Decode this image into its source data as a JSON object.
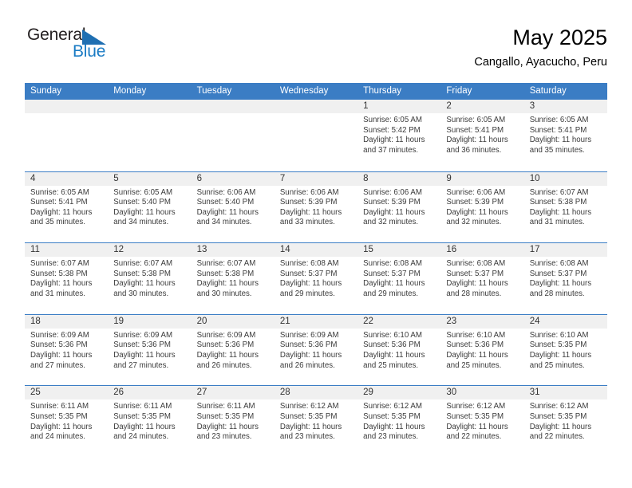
{
  "brand": {
    "name_part1": "General",
    "name_part2": "Blue",
    "flag_icon": "triangle-flag-icon"
  },
  "header": {
    "month_title": "May 2025",
    "location": "Cangallo, Ayacucho, Peru"
  },
  "calendar": {
    "accent_color": "#3b7dc4",
    "daynum_band_color": "#f0f0f0",
    "weekday_headers": [
      "Sunday",
      "Monday",
      "Tuesday",
      "Wednesday",
      "Thursday",
      "Friday",
      "Saturday"
    ],
    "weeks": [
      [
        {
          "day": "",
          "empty": true
        },
        {
          "day": "",
          "empty": true
        },
        {
          "day": "",
          "empty": true
        },
        {
          "day": "",
          "empty": true
        },
        {
          "day": "1",
          "sunrise": "Sunrise: 6:05 AM",
          "sunset": "Sunset: 5:42 PM",
          "daylight": "Daylight: 11 hours and 37 minutes."
        },
        {
          "day": "2",
          "sunrise": "Sunrise: 6:05 AM",
          "sunset": "Sunset: 5:41 PM",
          "daylight": "Daylight: 11 hours and 36 minutes."
        },
        {
          "day": "3",
          "sunrise": "Sunrise: 6:05 AM",
          "sunset": "Sunset: 5:41 PM",
          "daylight": "Daylight: 11 hours and 35 minutes."
        }
      ],
      [
        {
          "day": "4",
          "sunrise": "Sunrise: 6:05 AM",
          "sunset": "Sunset: 5:41 PM",
          "daylight": "Daylight: 11 hours and 35 minutes."
        },
        {
          "day": "5",
          "sunrise": "Sunrise: 6:05 AM",
          "sunset": "Sunset: 5:40 PM",
          "daylight": "Daylight: 11 hours and 34 minutes."
        },
        {
          "day": "6",
          "sunrise": "Sunrise: 6:06 AM",
          "sunset": "Sunset: 5:40 PM",
          "daylight": "Daylight: 11 hours and 34 minutes."
        },
        {
          "day": "7",
          "sunrise": "Sunrise: 6:06 AM",
          "sunset": "Sunset: 5:39 PM",
          "daylight": "Daylight: 11 hours and 33 minutes."
        },
        {
          "day": "8",
          "sunrise": "Sunrise: 6:06 AM",
          "sunset": "Sunset: 5:39 PM",
          "daylight": "Daylight: 11 hours and 32 minutes."
        },
        {
          "day": "9",
          "sunrise": "Sunrise: 6:06 AM",
          "sunset": "Sunset: 5:39 PM",
          "daylight": "Daylight: 11 hours and 32 minutes."
        },
        {
          "day": "10",
          "sunrise": "Sunrise: 6:07 AM",
          "sunset": "Sunset: 5:38 PM",
          "daylight": "Daylight: 11 hours and 31 minutes."
        }
      ],
      [
        {
          "day": "11",
          "sunrise": "Sunrise: 6:07 AM",
          "sunset": "Sunset: 5:38 PM",
          "daylight": "Daylight: 11 hours and 31 minutes."
        },
        {
          "day": "12",
          "sunrise": "Sunrise: 6:07 AM",
          "sunset": "Sunset: 5:38 PM",
          "daylight": "Daylight: 11 hours and 30 minutes."
        },
        {
          "day": "13",
          "sunrise": "Sunrise: 6:07 AM",
          "sunset": "Sunset: 5:38 PM",
          "daylight": "Daylight: 11 hours and 30 minutes."
        },
        {
          "day": "14",
          "sunrise": "Sunrise: 6:08 AM",
          "sunset": "Sunset: 5:37 PM",
          "daylight": "Daylight: 11 hours and 29 minutes."
        },
        {
          "day": "15",
          "sunrise": "Sunrise: 6:08 AM",
          "sunset": "Sunset: 5:37 PM",
          "daylight": "Daylight: 11 hours and 29 minutes."
        },
        {
          "day": "16",
          "sunrise": "Sunrise: 6:08 AM",
          "sunset": "Sunset: 5:37 PM",
          "daylight": "Daylight: 11 hours and 28 minutes."
        },
        {
          "day": "17",
          "sunrise": "Sunrise: 6:08 AM",
          "sunset": "Sunset: 5:37 PM",
          "daylight": "Daylight: 11 hours and 28 minutes."
        }
      ],
      [
        {
          "day": "18",
          "sunrise": "Sunrise: 6:09 AM",
          "sunset": "Sunset: 5:36 PM",
          "daylight": "Daylight: 11 hours and 27 minutes."
        },
        {
          "day": "19",
          "sunrise": "Sunrise: 6:09 AM",
          "sunset": "Sunset: 5:36 PM",
          "daylight": "Daylight: 11 hours and 27 minutes."
        },
        {
          "day": "20",
          "sunrise": "Sunrise: 6:09 AM",
          "sunset": "Sunset: 5:36 PM",
          "daylight": "Daylight: 11 hours and 26 minutes."
        },
        {
          "day": "21",
          "sunrise": "Sunrise: 6:09 AM",
          "sunset": "Sunset: 5:36 PM",
          "daylight": "Daylight: 11 hours and 26 minutes."
        },
        {
          "day": "22",
          "sunrise": "Sunrise: 6:10 AM",
          "sunset": "Sunset: 5:36 PM",
          "daylight": "Daylight: 11 hours and 25 minutes."
        },
        {
          "day": "23",
          "sunrise": "Sunrise: 6:10 AM",
          "sunset": "Sunset: 5:36 PM",
          "daylight": "Daylight: 11 hours and 25 minutes."
        },
        {
          "day": "24",
          "sunrise": "Sunrise: 6:10 AM",
          "sunset": "Sunset: 5:35 PM",
          "daylight": "Daylight: 11 hours and 25 minutes."
        }
      ],
      [
        {
          "day": "25",
          "sunrise": "Sunrise: 6:11 AM",
          "sunset": "Sunset: 5:35 PM",
          "daylight": "Daylight: 11 hours and 24 minutes."
        },
        {
          "day": "26",
          "sunrise": "Sunrise: 6:11 AM",
          "sunset": "Sunset: 5:35 PM",
          "daylight": "Daylight: 11 hours and 24 minutes."
        },
        {
          "day": "27",
          "sunrise": "Sunrise: 6:11 AM",
          "sunset": "Sunset: 5:35 PM",
          "daylight": "Daylight: 11 hours and 23 minutes."
        },
        {
          "day": "28",
          "sunrise": "Sunrise: 6:12 AM",
          "sunset": "Sunset: 5:35 PM",
          "daylight": "Daylight: 11 hours and 23 minutes."
        },
        {
          "day": "29",
          "sunrise": "Sunrise: 6:12 AM",
          "sunset": "Sunset: 5:35 PM",
          "daylight": "Daylight: 11 hours and 23 minutes."
        },
        {
          "day": "30",
          "sunrise": "Sunrise: 6:12 AM",
          "sunset": "Sunset: 5:35 PM",
          "daylight": "Daylight: 11 hours and 22 minutes."
        },
        {
          "day": "31",
          "sunrise": "Sunrise: 6:12 AM",
          "sunset": "Sunset: 5:35 PM",
          "daylight": "Daylight: 11 hours and 22 minutes."
        }
      ]
    ]
  }
}
